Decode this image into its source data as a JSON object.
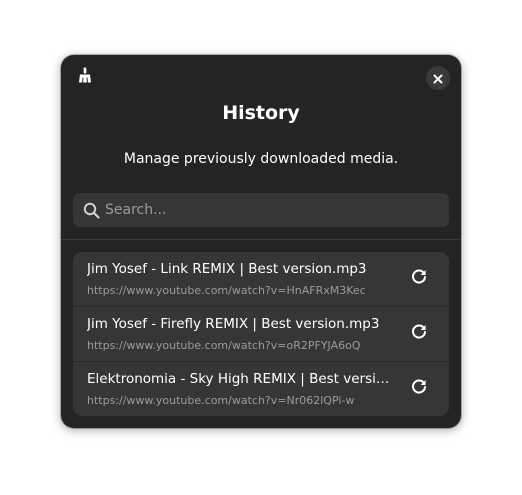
{
  "header": {
    "title": "History",
    "subtitle": "Manage previously downloaded media."
  },
  "search": {
    "placeholder": "Search...",
    "value": ""
  },
  "icons": {
    "clear": "broom-icon",
    "close": "close-icon",
    "search": "search-icon",
    "redownload": "refresh-icon"
  },
  "history": {
    "items": [
      {
        "title": "Jim Yosef - Link REMIX | Best version.mp3",
        "url": "https://www.youtube.com/watch?v=HnAFRxM3Kec"
      },
      {
        "title": "Jim Yosef - Firefly REMIX | Best version.mp3",
        "url": "https://www.youtube.com/watch?v=oR2PFYJA6oQ"
      },
      {
        "title": "Elektronomia - Sky High REMIX | Best version…",
        "url": "https://www.youtube.com/watch?v=Nr062lQPi-w"
      }
    ]
  },
  "colors": {
    "dialog_bg": "#242424",
    "card_bg": "#363636",
    "text": "#ffffff",
    "muted_text": "#9b9b9b"
  }
}
